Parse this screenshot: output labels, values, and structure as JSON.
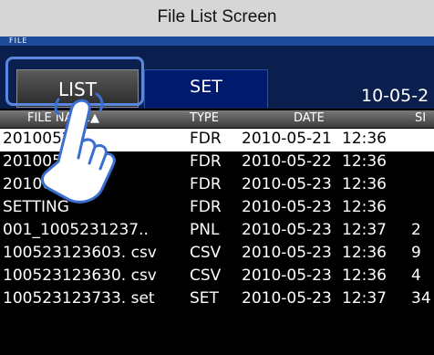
{
  "caption": "File List Screen",
  "window": {
    "title": "FILE"
  },
  "tabs": {
    "list_label": "LIST",
    "set_label": "SET"
  },
  "date_readout": "10-05-2",
  "table": {
    "headers": {
      "name": "FILE NAME▲",
      "type": "TYPE",
      "date": "DATE",
      "size": "SI"
    },
    "rows": [
      {
        "name": "20100521",
        "type": "FDR",
        "date": "2010-05-21",
        "time": "12:36",
        "size": "",
        "selected": true
      },
      {
        "name": "20100522",
        "type": "FDR",
        "date": "2010-05-22",
        "time": "12:36",
        "size": ""
      },
      {
        "name": "20100523",
        "type": "FDR",
        "date": "2010-05-23",
        "time": "12:36",
        "size": ""
      },
      {
        "name": "SETTING",
        "type": "FDR",
        "date": "2010-05-23",
        "time": "12:36",
        "size": ""
      },
      {
        "name": "001_1005231237..",
        "type": "PNL",
        "date": "2010-05-23",
        "time": "12:37",
        "size": "2"
      },
      {
        "name": "100523123603. csv",
        "type": "CSV",
        "date": "2010-05-23",
        "time": "12:36",
        "size": "9"
      },
      {
        "name": "100523123630. csv",
        "type": "CSV",
        "date": "2010-05-23",
        "time": "12:36",
        "size": "4"
      },
      {
        "name": "100523123733. set",
        "type": "SET",
        "date": "2010-05-23",
        "time": "12:37",
        "size": "34"
      }
    ]
  },
  "icons": {
    "pointer": "tap-hand-icon"
  },
  "colors": {
    "screen_bg": "#000000",
    "tab_active": "#001a6e",
    "highlight": "#5a87e0",
    "title_bar": "#1d4b9a"
  }
}
